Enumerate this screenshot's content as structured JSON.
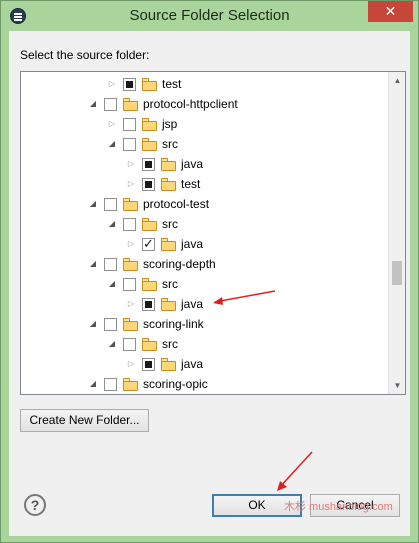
{
  "window": {
    "title": "Source Folder Selection",
    "close_glyph": "✕"
  },
  "prompt": "Select the source folder:",
  "tree": {
    "rows": [
      {
        "label": "test",
        "expander": "collapsed",
        "check": "partial"
      },
      {
        "label": "protocol-httpclient",
        "expander": "expanded",
        "check": "none"
      },
      {
        "label": "jsp",
        "expander": "collapsed",
        "check": "none"
      },
      {
        "label": "src",
        "expander": "expanded",
        "check": "none"
      },
      {
        "label": "java",
        "expander": "collapsed",
        "check": "partial"
      },
      {
        "label": "test",
        "expander": "collapsed",
        "check": "partial"
      },
      {
        "label": "protocol-test",
        "expander": "expanded",
        "check": "none"
      },
      {
        "label": "src",
        "expander": "expanded",
        "check": "none"
      },
      {
        "label": "java",
        "expander": "collapsed",
        "check": "checked"
      },
      {
        "label": "scoring-depth",
        "expander": "expanded",
        "check": "none"
      },
      {
        "label": "src",
        "expander": "expanded",
        "check": "none"
      },
      {
        "label": "java",
        "expander": "collapsed",
        "check": "partial"
      },
      {
        "label": "scoring-link",
        "expander": "expanded",
        "check": "none"
      },
      {
        "label": "src",
        "expander": "expanded",
        "check": "none"
      },
      {
        "label": "java",
        "expander": "collapsed",
        "check": "partial"
      },
      {
        "label": "scoring-opic",
        "expander": "expanded",
        "check": "none"
      }
    ]
  },
  "buttons": {
    "create_folder": "Create New Folder...",
    "ok": "OK",
    "cancel": "Cancel",
    "help": "?"
  },
  "watermark": "木杉 mushanblog.com",
  "annotation_color": "#e02020"
}
